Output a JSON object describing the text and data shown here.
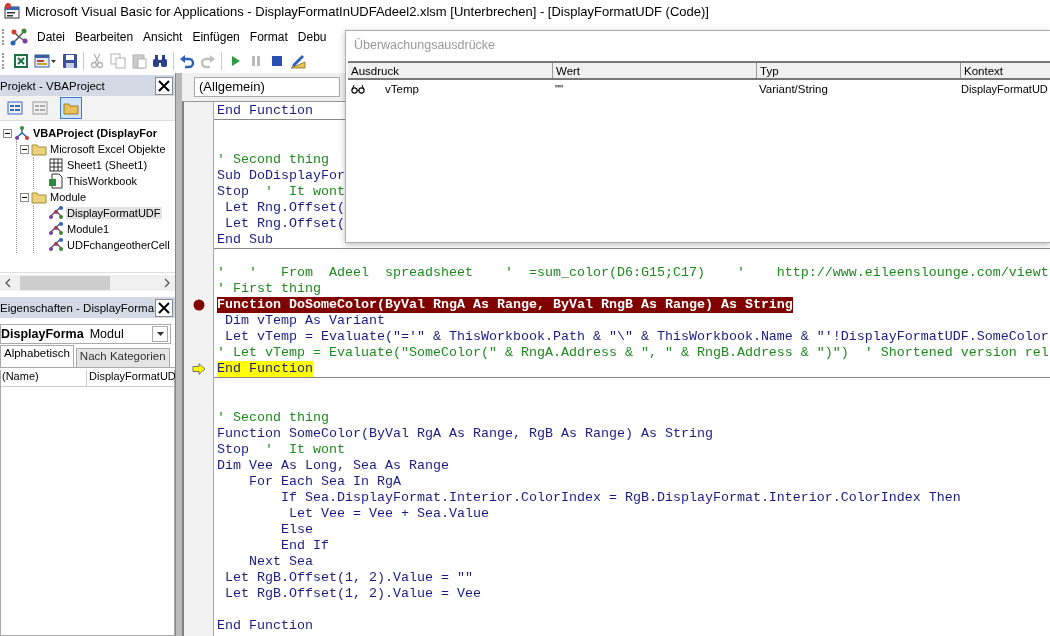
{
  "window": {
    "title": "Microsoft Visual Basic for Applications - DisplayFormatInUDFAdeel2.xlsm [Unterbrechen] - [DisplayFormatUDF (Code)]"
  },
  "menu": [
    "Datei",
    "Bearbeiten",
    "Ansicht",
    "Einfügen",
    "Format",
    "Debu"
  ],
  "toolbar_groups": [
    {
      "buttons": [
        {
          "kind": "excel",
          "disabled": false
        },
        {
          "kind": "userform",
          "disabled": false
        },
        {
          "kind": "save",
          "disabled": false
        }
      ]
    },
    {
      "buttons": [
        {
          "kind": "cut",
          "disabled": true
        },
        {
          "kind": "copy",
          "disabled": true
        },
        {
          "kind": "paste",
          "disabled": true
        },
        {
          "kind": "find",
          "disabled": false
        }
      ]
    },
    {
      "buttons": [
        {
          "kind": "undo",
          "disabled": false
        },
        {
          "kind": "redo",
          "disabled": true
        }
      ]
    },
    {
      "buttons": [
        {
          "kind": "run",
          "disabled": false
        },
        {
          "kind": "pause",
          "disabled": true
        },
        {
          "kind": "stop",
          "disabled": false
        },
        {
          "kind": "design",
          "disabled": false
        }
      ]
    }
  ],
  "project_pane": {
    "title": "Projekt - VBAProject",
    "buttons": [
      {
        "kind": "view-code",
        "selected": false
      },
      {
        "kind": "view-object",
        "selected": false
      },
      {
        "kind": "toggle-folders",
        "selected": true
      }
    ],
    "tree": [
      {
        "label": "VBAProject (DisplayFor",
        "kind": "project",
        "expanded": true,
        "selected": false,
        "children": [
          {
            "label": "Microsoft Excel Objekte",
            "kind": "folder",
            "expanded": true,
            "selected": false,
            "children": [
              {
                "label": "Sheet1 (Sheet1)",
                "kind": "sheet",
                "selected": false
              },
              {
                "label": "ThisWorkbook",
                "kind": "workbook",
                "selected": false
              }
            ]
          },
          {
            "label": "Module",
            "kind": "folder",
            "expanded": true,
            "selected": false,
            "children": [
              {
                "label": "DisplayFormatUDF",
                "kind": "module",
                "selected": true
              },
              {
                "label": "Module1",
                "kind": "module",
                "selected": false
              },
              {
                "label": "UDFchangeotherCell",
                "kind": "module",
                "selected": false
              }
            ]
          }
        ]
      }
    ]
  },
  "properties_pane": {
    "title": "Eigenschaften - DisplayForma",
    "object": {
      "name": "DisplayForma",
      "type": "Modul"
    },
    "tabs": [
      {
        "label": "Alphabetisch",
        "selected": true
      },
      {
        "label": "Nach Kategorien",
        "selected": false
      }
    ],
    "rows": [
      {
        "name": "(Name)",
        "value": "DisplayFormatUD"
      }
    ]
  },
  "code_window": {
    "object_combo": "(Allgemein)",
    "procedures": [
      {
        "lines": [
          {
            "kind": "code",
            "code": "End Function",
            "breakpoint": false,
            "current": false
          }
        ]
      },
      {
        "lines": [
          {
            "kind": "blank"
          },
          {
            "kind": "blank"
          },
          {
            "comment": "' Second thing",
            "breakpoint": false,
            "current": false
          },
          {
            "code": "Sub DoDisplayFor",
            "breakpoint": false,
            "current": false
          },
          {
            "code": "Stop  ",
            "comment": "'  It wont",
            "breakpoint": false,
            "current": false
          },
          {
            "code": " Let Rng.Offset(",
            "breakpoint": false,
            "current": false
          },
          {
            "code": " Let Rng.Offset(",
            "breakpoint": false,
            "current": false
          },
          {
            "code": "End Sub",
            "breakpoint": false,
            "current": false
          }
        ]
      },
      {
        "lines": [
          {
            "kind": "blank"
          },
          {
            "comment": "'   '   From  Adeel  spreadsheet    '  =sum_color(D6:G15;C17)    '    http://www.eileenslounge.com/viewt",
            "breakpoint": false,
            "current": false
          },
          {
            "comment": "' First thing",
            "breakpoint": false,
            "current": false
          },
          {
            "code": "Function DoSomeColor(ByVal RngA As Range, ByVal RngB As Range) As String",
            "breakpoint": true,
            "current": false
          },
          {
            "code": " Dim vTemp As Variant",
            "breakpoint": false,
            "current": false
          },
          {
            "code": " Let vTemp = Evaluate(\"='\" & ThisWorkbook.Path & \"\\\" & ThisWorkbook.Name & \"'!DisplayFormatUDF.SomeColor",
            "breakpoint": false,
            "current": false
          },
          {
            "comment": "' Let vTemp = Evaluate(\"SomeColor(\" & RngA.Address & \", \" & RngB.Address & \")\")  ' Shortened version rel",
            "breakpoint": false,
            "current": false
          },
          {
            "code": "End Function",
            "breakpoint": false,
            "current": true
          }
        ]
      },
      {
        "lines": [
          {
            "kind": "blank"
          },
          {
            "kind": "blank"
          },
          {
            "comment": "' Second thing",
            "breakpoint": false,
            "current": false
          },
          {
            "code": "Function SomeColor(ByVal RgA As Range, RgB As Range) As String",
            "breakpoint": false,
            "current": false
          },
          {
            "code": "Stop  ",
            "comment": "'  It wont",
            "breakpoint": false,
            "current": false
          },
          {
            "code": "Dim Vee As Long, Sea As Range",
            "breakpoint": false,
            "current": false
          },
          {
            "code": "    For Each Sea In RgA",
            "breakpoint": false,
            "current": false
          },
          {
            "code": "        If Sea.DisplayFormat.Interior.ColorIndex = RgB.DisplayFormat.Interior.ColorIndex Then",
            "breakpoint": false,
            "current": false
          },
          {
            "code": "         Let Vee = Vee + Sea.Value",
            "breakpoint": false,
            "current": false
          },
          {
            "code": "        Else",
            "breakpoint": false,
            "current": false
          },
          {
            "code": "        End If",
            "breakpoint": false,
            "current": false
          },
          {
            "code": "    Next Sea",
            "breakpoint": false,
            "current": false
          },
          {
            "code": " Let RgB.Offset(1, 2).Value = \"\"",
            "breakpoint": false,
            "current": false
          },
          {
            "code": " Let RgB.Offset(1, 2).Value = Vee",
            "breakpoint": false,
            "current": false
          },
          {
            "kind": "blank"
          },
          {
            "code": "End Function",
            "breakpoint": false,
            "current": false
          }
        ]
      }
    ]
  },
  "watch_window": {
    "title": "Überwachungsausdrücke",
    "columns": [
      "Ausdruck",
      "Wert",
      "Typ",
      "Kontext"
    ],
    "rows": [
      {
        "expression": "vTemp",
        "value": "\"\"",
        "type": "Variant/String",
        "context": "DisplayFormatUD"
      }
    ]
  }
}
